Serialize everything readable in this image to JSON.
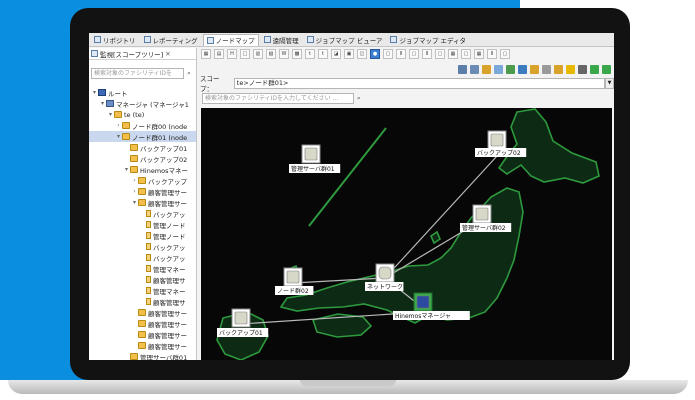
{
  "tabs": [
    "リポジトリ",
    "レポーティング",
    "ノードマップ",
    "遠隔管理",
    "ジョブマップ ビューア",
    "ジョブマップ エディタ"
  ],
  "tabs_active_index": 2,
  "scope_view": {
    "title": "監視[スコープツリー]",
    "search_placeholder": "検索対象のファシリティIDを",
    "tree": [
      {
        "label": "ルート",
        "level": 0,
        "icon": "root",
        "expand": "▾"
      },
      {
        "label": "マネージャ (マネージャ1",
        "level": 1,
        "icon": "mgr",
        "expand": "▾"
      },
      {
        "label": "te (te)",
        "level": 2,
        "icon": "folder",
        "expand": "▾"
      },
      {
        "label": "ノード群00 (node",
        "level": 3,
        "icon": "folder",
        "expand": "›"
      },
      {
        "label": "ノード群01 (node",
        "level": 3,
        "icon": "folder",
        "expand": "▾",
        "selected": true
      },
      {
        "label": "バックアップ01",
        "level": 4,
        "icon": "folder",
        "expand": ""
      },
      {
        "label": "バックアップ02",
        "level": 4,
        "icon": "folder",
        "expand": ""
      },
      {
        "label": "Hinemosマネー",
        "level": 4,
        "icon": "folder",
        "expand": "▾"
      },
      {
        "label": "バックアップ",
        "level": 5,
        "icon": "folder",
        "expand": "›"
      },
      {
        "label": "顧客管理サー",
        "level": 5,
        "icon": "folder",
        "expand": "›"
      },
      {
        "label": "顧客管理サー",
        "level": 5,
        "icon": "folder",
        "expand": "▾"
      },
      {
        "label": "バックアッ",
        "level": 6,
        "icon": "node",
        "expand": ""
      },
      {
        "label": "管理ノード",
        "level": 6,
        "icon": "node",
        "expand": ""
      },
      {
        "label": "管理ノード",
        "level": 6,
        "icon": "node",
        "expand": ""
      },
      {
        "label": "バックアッ",
        "level": 6,
        "icon": "node",
        "expand": ""
      },
      {
        "label": "バックアッ",
        "level": 6,
        "icon": "node",
        "expand": ""
      },
      {
        "label": "管理マネー",
        "level": 6,
        "icon": "node",
        "expand": ""
      },
      {
        "label": "顧客管理サ",
        "level": 6,
        "icon": "node",
        "expand": ""
      },
      {
        "label": "管理マネー",
        "level": 6,
        "icon": "node",
        "expand": ""
      },
      {
        "label": "顧客管理サ",
        "level": 6,
        "icon": "node",
        "expand": ""
      },
      {
        "label": "顧客管理サー",
        "level": 5,
        "icon": "folder",
        "expand": ""
      },
      {
        "label": "顧客管理サー",
        "level": 5,
        "icon": "folder",
        "expand": ""
      },
      {
        "label": "顧客管理サー",
        "level": 5,
        "icon": "folder",
        "expand": ""
      },
      {
        "label": "顧客管理サー",
        "level": 5,
        "icon": "folder",
        "expand": ""
      },
      {
        "label": "管理サーバ群01",
        "level": 4,
        "icon": "folder",
        "expand": ""
      }
    ]
  },
  "map_view": {
    "scope_label": "スコープ：",
    "scope_value": "te>ノード群01>",
    "search_placeholder": "検索対象のファシリティIDを入力してください ...",
    "nodes": [
      {
        "label": "管理サーバ群01",
        "kind": "server"
      },
      {
        "label": "バックアップ02",
        "kind": "server"
      },
      {
        "label": "管理サーバ群02",
        "kind": "server"
      },
      {
        "label": "ネットワーク",
        "kind": "network"
      },
      {
        "label": "ノード群02",
        "kind": "server"
      },
      {
        "label": "バックアップ01",
        "kind": "server"
      },
      {
        "label": "Hinemosマネージャ",
        "kind": "manager"
      }
    ]
  },
  "colors": {
    "background_blue": "#0a8ee0",
    "map_background": "#070707",
    "map_land_fill": "#0d2a14",
    "map_land_stroke": "#2e9a3e",
    "link_color": "#b8b8b8",
    "selection": "#c9d8ee"
  }
}
